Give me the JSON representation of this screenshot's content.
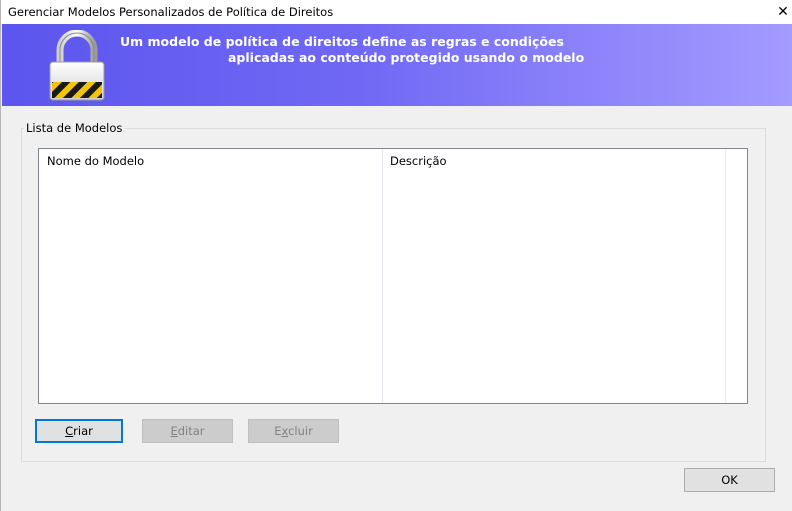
{
  "window": {
    "title": "Gerenciar Modelos Personalizados de Política de Direitos",
    "close_glyph": "✕"
  },
  "banner": {
    "icon": "padlock-icon",
    "line1": "Um modelo de política de direitos define as regras e condições",
    "line2": "aplicadas ao conteúdo protegido usando o modelo",
    "gradient_start": "#5c55ee",
    "gradient_end": "#a49bff"
  },
  "group": {
    "legend": "Lista de Modelos"
  },
  "list": {
    "columns": [
      "Nome do Modelo",
      "Descrição"
    ],
    "rows": []
  },
  "buttons": {
    "create": {
      "acc": "C",
      "rest": "riar",
      "enabled": true
    },
    "edit": {
      "acc": "E",
      "rest": "ditar",
      "enabled": false
    },
    "delete": {
      "pre": "E",
      "acc": "x",
      "rest": "cluir",
      "enabled": false
    },
    "ok": {
      "label": "OK",
      "enabled": true
    }
  },
  "colors": {
    "focus_border": "#0078d7",
    "disabled_text": "#838383"
  }
}
